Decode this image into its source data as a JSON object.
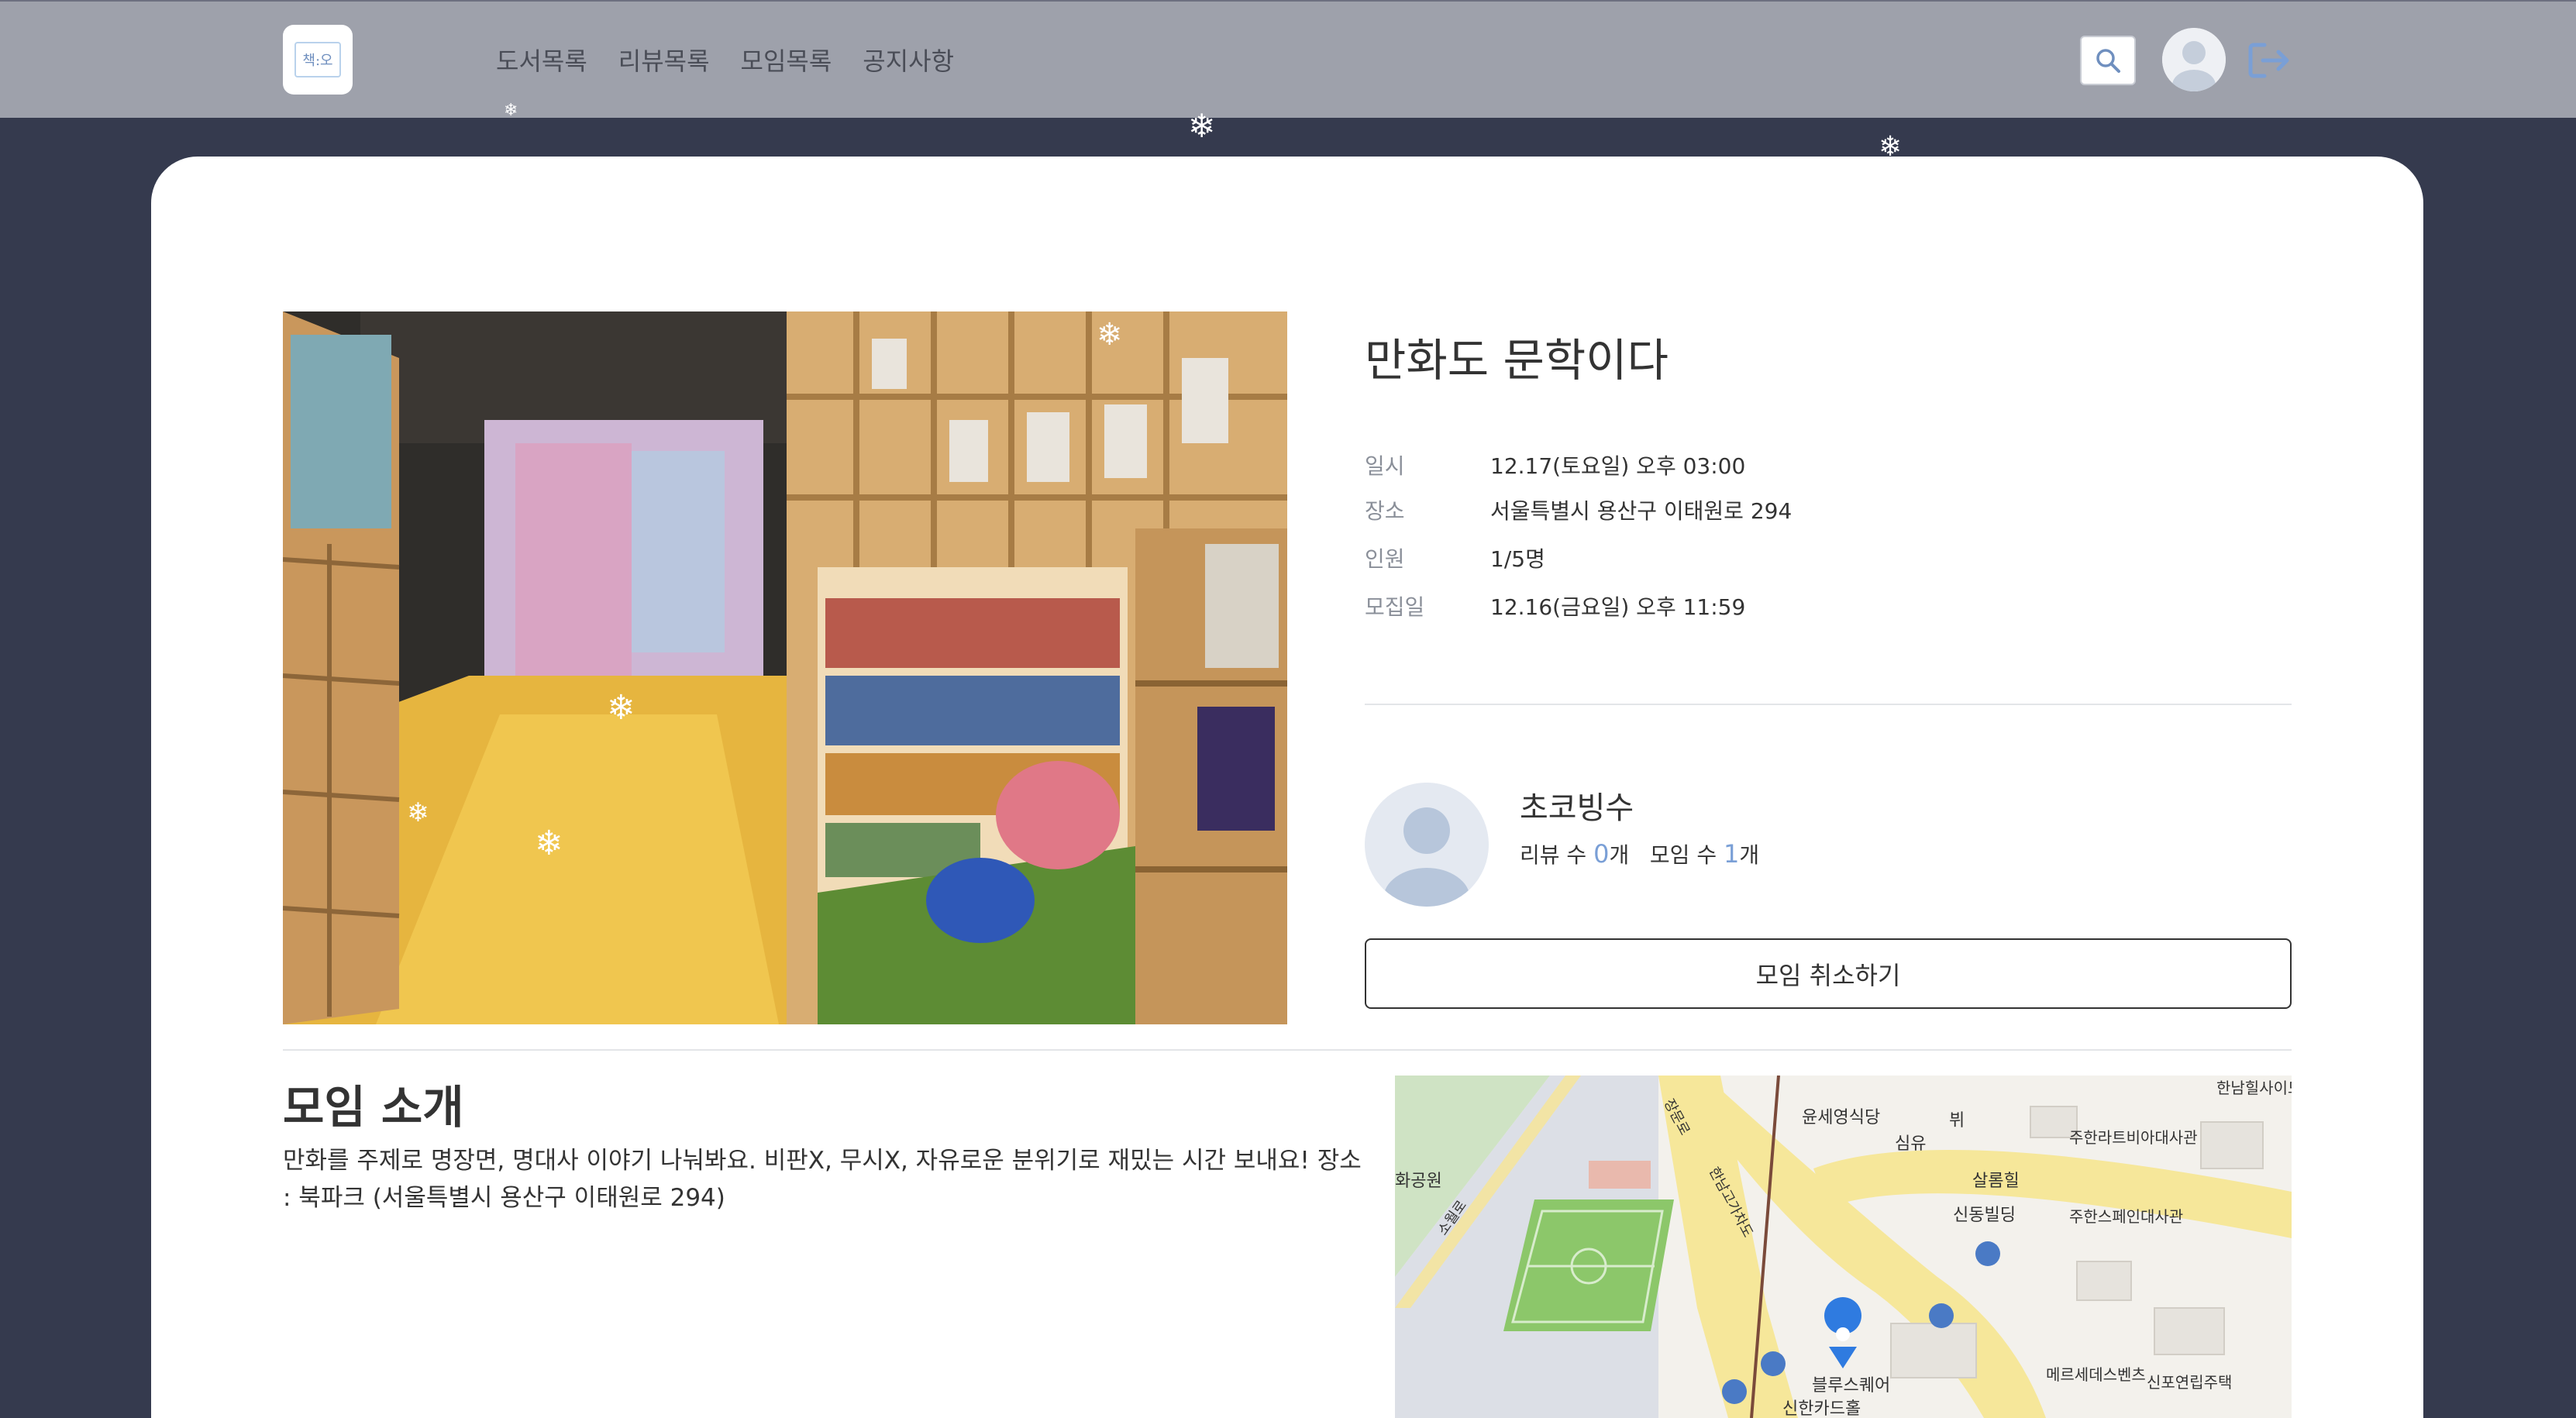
{
  "header": {
    "logo_text": "책:오",
    "nav": [
      "도서목록",
      "리뷰목록",
      "모임목록",
      "공지사항"
    ]
  },
  "meeting": {
    "title": "만화도 문학이다",
    "info": [
      {
        "label": "일시",
        "value": "12.17(토요일) 오후 03:00"
      },
      {
        "label": "장소",
        "value": "서울특별시 용산구 이태원로 294"
      },
      {
        "label": "인원",
        "value": "1/5명"
      },
      {
        "label": "모집일",
        "value": "12.16(금요일) 오후 11:59"
      }
    ]
  },
  "host": {
    "name": "초코빙수",
    "review_label": "리뷰 수",
    "review_count": "0",
    "count_suffix": "개",
    "meeting_label": "모임 수",
    "meeting_count": "1"
  },
  "cancel_label": "모임 취소하기",
  "intro": {
    "title": "모임 소개",
    "text": "만화를 주제로 명장면, 명대사 이야기 나눠봐요. 비판X, 무시X, 자유로운 분위기로 재밌는 시간 보내요! 장소 : 북파크 (서울특별시 용산구 이태원로 294)"
  },
  "map": {
    "labels": [
      "윤세영식당",
      "심유",
      "뷔",
      "한남힐사이드아파트",
      "주한라트비아대사관",
      "살롬힐",
      "신동빌딩",
      "주한스페인대사관",
      "블루스퀘어",
      "신한카드홀",
      "메르세데스벤츠",
      "신포연립주택",
      "화공원",
      "소월로",
      "장문로",
      "한남고가차도"
    ]
  },
  "icons": {
    "search": "search-icon",
    "logout": "logout-icon",
    "avatar": "user-avatar-icon",
    "map_pin": "map-pin-icon",
    "snowflake": "snowflake-icon"
  },
  "colors": {
    "header_bg": "#9ea1ab",
    "page_bg": "#353a4e",
    "accent": "#7a9fd6"
  }
}
